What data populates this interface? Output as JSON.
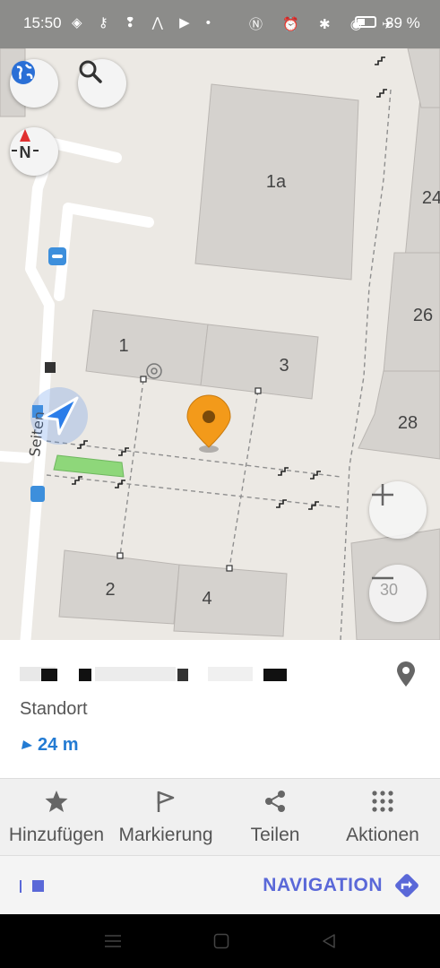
{
  "status_bar": {
    "time": "15:50",
    "battery_percent": "39 %",
    "icons_left": [
      "shield-icon",
      "key-icon",
      "notification-icon",
      "m-icon",
      "youtube-icon",
      "dot-icon"
    ],
    "icons_right": [
      "nfc-icon",
      "alarm-icon",
      "bluetooth-icon",
      "location-icon",
      "airplane-icon",
      "battery-icon"
    ]
  },
  "map": {
    "building_labels": [
      "1a",
      "24",
      "26",
      "28",
      "1",
      "3",
      "2",
      "4"
    ],
    "zoom_badge": "30"
  },
  "card": {
    "title": "",
    "subtitle": "Standort",
    "distance": "24 m"
  },
  "actions": [
    {
      "label": "Hinzufügen",
      "icon": "star-icon"
    },
    {
      "label": "Markierung",
      "icon": "flag-icon"
    },
    {
      "label": "Teilen",
      "icon": "share-icon"
    },
    {
      "label": "Aktionen",
      "icon": "grid-dots-icon"
    }
  ],
  "navigation": {
    "label": "NAVIGATION"
  },
  "colors": {
    "accent": "#5a68d8",
    "distance": "#237bd3",
    "poi_marker": "#f39a1a",
    "location_arrow": "#2b7de9"
  }
}
